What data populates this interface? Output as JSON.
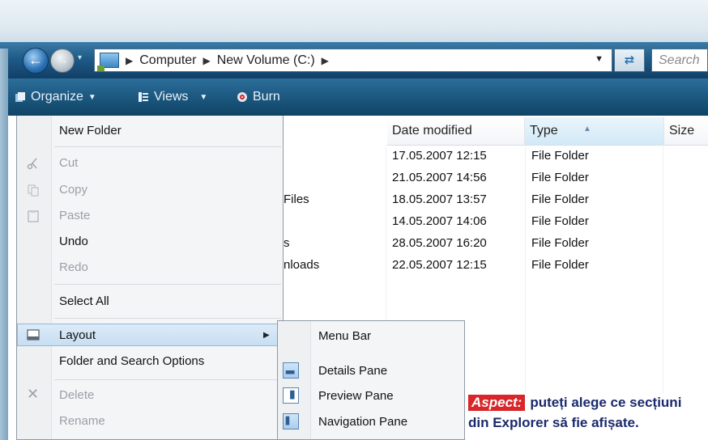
{
  "address": {
    "crumbs": [
      "Computer",
      "New Volume (C:)"
    ],
    "search_placeholder": "Search"
  },
  "toolbar": {
    "organize_label": "Organize",
    "views_label": "Views",
    "burn_label": "Burn"
  },
  "columns": {
    "date": "Date modified",
    "type": "Type",
    "size": "Size"
  },
  "rows": [
    {
      "name_fragment": "",
      "date": "17.05.2007 12:15",
      "type": "File Folder"
    },
    {
      "name_fragment": "",
      "date": "21.05.2007 14:56",
      "type": "File Folder"
    },
    {
      "name_fragment": "Files",
      "date": "18.05.2007 13:57",
      "type": "File Folder"
    },
    {
      "name_fragment": "",
      "date": "14.05.2007 14:06",
      "type": "File Folder"
    },
    {
      "name_fragment": "s",
      "date": "28.05.2007 16:20",
      "type": "File Folder"
    },
    {
      "name_fragment": "nloads",
      "date": "22.05.2007 12:15",
      "type": "File Folder"
    }
  ],
  "menu": {
    "new_folder": "New Folder",
    "cut": "Cut",
    "copy": "Copy",
    "paste": "Paste",
    "undo": "Undo",
    "redo": "Redo",
    "select_all": "Select All",
    "layout": "Layout",
    "folder_options": "Folder and Search Options",
    "delete": "Delete",
    "rename": "Rename"
  },
  "submenu": {
    "menu_bar": "Menu Bar",
    "details_pane": "Details Pane",
    "preview_pane": "Preview Pane",
    "navigation_pane": "Navigation Pane"
  },
  "caption": {
    "badge": "Aspect:",
    "line1": "puteți alege ce secțiuni",
    "line2": "din Explorer să fie afișate."
  },
  "colors": {
    "toolbar": "#1c587f",
    "caption_text": "#1a2a6c",
    "caption_badge": "#d8262a",
    "highlight": "#c7def2"
  }
}
